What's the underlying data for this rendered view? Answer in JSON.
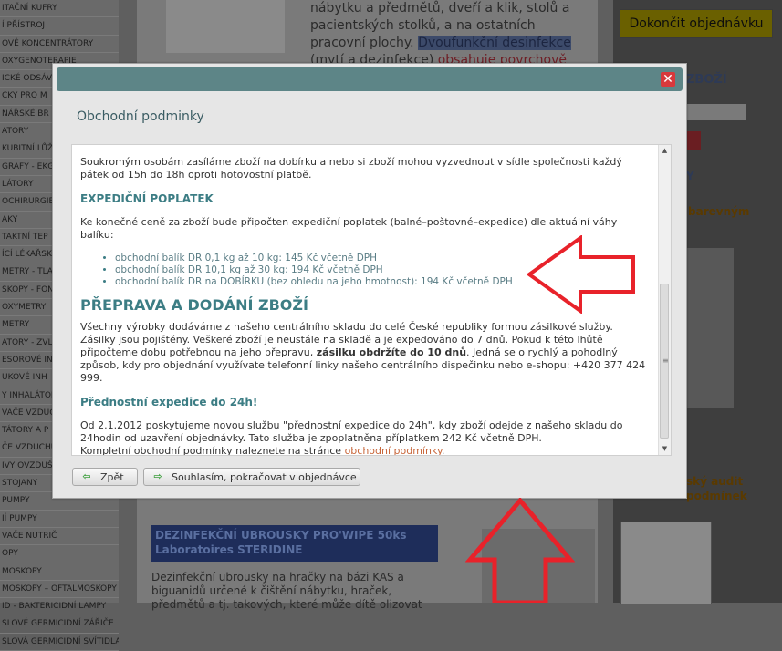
{
  "background": {
    "sidebar_items": [
      "ITAČNÍ KUFRY",
      "Í PŘÍSTROJ",
      "OVÉ KONCENTRÁTORY",
      "OXYGENOTERAPIE",
      "ICKÉ ODSÁV",
      "CKY PRO M",
      "NÁŘSKÉ BR",
      "ATORY",
      "KUBITNÍ LŮŽ",
      "GRAFY - EKG",
      "LÁTORY",
      "OCHIRURGIE",
      "AKY",
      "TAKTNÍ TEP",
      "ÍCÍ LÉKAŘSK",
      "METRY - TLAK",
      "SKOPY - FON",
      "OXYMETRY",
      "METRY",
      "ATORY - ZVLH",
      "ESOROVÉ IN",
      "UKOVÉ INH",
      "Y INHALÁTOR",
      "VAČE VZDUC",
      "TÁTORY A P",
      "ČE VZDUCHU",
      "IVY OVZDUŠÍ",
      "STOJANY",
      "PUMPY",
      "IÍ PUMPY",
      "VAČE NUTRIČ",
      "OPY",
      "MOSKOPY",
      "MOSKOPY – OFTALMOSKOPY",
      "ID - BAKTERICIDNÍ LAMPY",
      "SLOVÉ GERMICIDNÍ ZÁŘIČE",
      "SLOVÁ GERMICIDNÍ SVÍTIDLA"
    ],
    "top_text_1": "nábytku a předmětů, dveří a klik, stolů a pacientských stolků, a na ostatních pracovní plochy.",
    "top_text_highlight": "Dvoufunkční desinfekce",
    "top_text_2": "(mytí a dezinfekce)",
    "top_text_red": "obsahuje povrchově aktivní látky",
    "finish_order_button": "Dokončit objednávku",
    "right_label_1": "ZBOŽÍ",
    "right_label_2": "Y",
    "right_label_3": "barevným",
    "audit_line_1": "ský audit",
    "audit_line_2": "podmínek",
    "product_title": "DEZINFEKČNÍ UBROUSKY PRO'WIPE 50ks Laboratoires STERIDINE",
    "product_text": "Dezinfekční ubrousky na hračky na bázi KAS a biguanidů určené k čištění nábytku, hraček, předmětů a tj. takových, které může dítě olizovat"
  },
  "modal": {
    "title": "Obchodní podminky",
    "close_label": "✕",
    "p_intro": "Soukromým osobám zasíláme zboží na dobírku a nebo si zboží mohou vyzvednout v sídle společnosti každý pátek od 15h do 18h oproti hotovostní platbě.",
    "h_expedition": "EXPEDIČNÍ POPLATEK",
    "p_expedition": "Ke konečné ceně za zboží bude připočten expediční poplatek (balné–poštovné–expedice) dle aktuální váhy balíku:",
    "bullets": [
      "obchodní balík DR 0,1 kg až 10 kg: 145 Kč včetně DPH",
      "obchodní balík DR 10,1 kg až 30 kg: 194 Kč včetně DPH",
      "obchodní balík DR na DOBÍRKU (bez ohledu na jeho hmotnost): 194 Kč včetně DPH"
    ],
    "h_delivery": "PŘEPRAVA A DODÁNÍ ZBOŽÍ",
    "p_delivery_1": "Všechny výrobky dodáváme z našeho centrálního skladu do celé České republiky formou zásilkové služby. Zásilky jsou pojištěny. Veškeré zboží je neustále na skladě a je expedováno do 7 dnů. Pokud k této lhůtě připočteme dobu potřebnou na jeho přepravu,",
    "p_delivery_bold": "zásilku obdržíte do 10 dnů",
    "p_delivery_2": ". Jedná se o rychlý a pohodlný způsob, kdy pro objednání využívate telefonní linky našeho centrálního dispečinku nebo e-shopu: +420 377 424 999.",
    "h_priority": "Přednostní expedice do 24h!",
    "p_priority": "Od 2.1.2012 poskytujeme novou službu \"přednostní expedice do 24h\", kdy zboží odejde z našeho skladu do 24hodin od uzavření objednávky. Tato služba je zpoplatněna příplatkem 242 Kč včetně DPH.",
    "p_full_terms": "Kompletní obchodní podmínky naleznete na stránce",
    "link_terms": "obchodní podmínky",
    "btn_back": "Zpět",
    "btn_agree": "Souhlasím, pokračovat v objednávce"
  },
  "colors": {
    "accent_teal": "#3c7d84",
    "header_bar": "#5d8587",
    "annotation_red": "#e8222a",
    "link_orange": "#c8663a"
  }
}
